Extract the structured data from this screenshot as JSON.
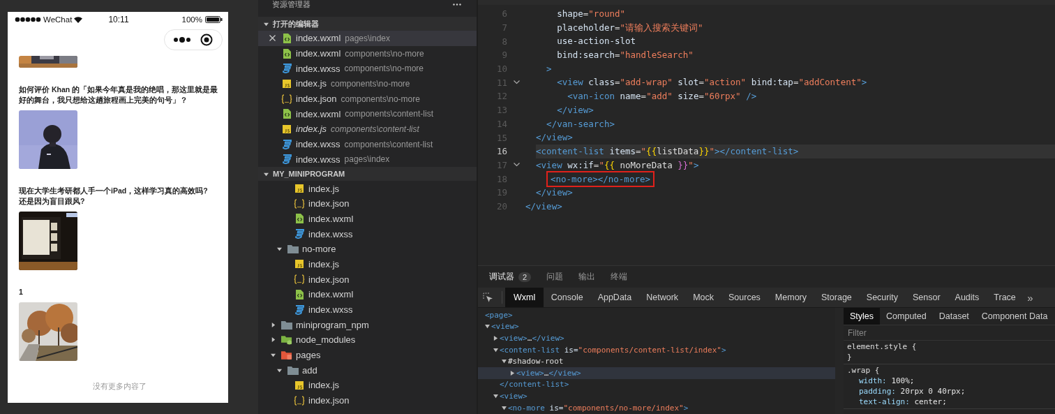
{
  "phone": {
    "status": {
      "carrier": "WeChat",
      "time": "10:11",
      "battery": "100%"
    },
    "posts": [
      {
        "kind": "picture"
      },
      {
        "title": "如何评价 Khan 的「如果今年真是我的绝唱，那这里就是最好的舞台，我只想给这趟旅程画上完美的句号」？",
        "kind": "picture"
      },
      {
        "title": "现在大学生考研都人手一个iPad，这样学习真的高效吗?\n还是因为盲目跟风?",
        "kind": "picture"
      },
      {
        "title": "1",
        "kind": "picture"
      }
    ],
    "footer": "没有更多内容了"
  },
  "explorer": {
    "title": "资源管理器",
    "open_editors": {
      "label": "打开的编辑器",
      "expanded": true,
      "items": [
        {
          "name": "index.wxml",
          "path": "pages\\index",
          "kind": "wxml",
          "selected": true,
          "preview": false
        },
        {
          "name": "index.wxml",
          "path": "components\\no-more",
          "kind": "wxml",
          "selected": false,
          "preview": false
        },
        {
          "name": "index.wxss",
          "path": "components\\no-more",
          "kind": "wxss",
          "selected": false,
          "preview": false
        },
        {
          "name": "index.js",
          "path": "components\\no-more",
          "kind": "js",
          "selected": false,
          "preview": false
        },
        {
          "name": "index.json",
          "path": "components\\no-more",
          "kind": "json",
          "selected": false,
          "preview": false
        },
        {
          "name": "index.wxml",
          "path": "components\\content-list",
          "kind": "wxml",
          "selected": false,
          "preview": false
        },
        {
          "name": "index.js",
          "path": "components\\content-list",
          "kind": "js",
          "selected": false,
          "preview": true
        },
        {
          "name": "index.wxss",
          "path": "components\\content-list",
          "kind": "wxss",
          "selected": false,
          "preview": false
        },
        {
          "name": "index.wxss",
          "path": "pages\\index",
          "kind": "wxss",
          "selected": false,
          "preview": false
        }
      ]
    },
    "project": {
      "label": "MY_MINIPROGRAM",
      "expanded": true,
      "tree": [
        {
          "kind": "continued",
          "children": [
            {
              "kind": "continued",
              "children": [
                {
                  "kind": "js",
                  "name": "index.js"
                },
                {
                  "kind": "json",
                  "name": "index.json"
                },
                {
                  "kind": "wxml",
                  "name": "index.wxml"
                },
                {
                  "kind": "wxss",
                  "name": "index.wxss"
                }
              ]
            },
            {
              "kind": "folder",
              "name": "no-more",
              "expanded": true,
              "children": [
                {
                  "kind": "js",
                  "name": "index.js"
                },
                {
                  "kind": "json",
                  "name": "index.json"
                },
                {
                  "kind": "wxml",
                  "name": "index.wxml"
                },
                {
                  "kind": "wxss",
                  "name": "index.wxss"
                }
              ]
            }
          ]
        },
        {
          "kind": "folder",
          "name": "miniprogram_npm",
          "expanded": false
        },
        {
          "kind": "node-folder",
          "name": "node_modules",
          "expanded": false
        },
        {
          "kind": "pages-folder",
          "name": "pages",
          "expanded": true,
          "children": [
            {
              "kind": "folder",
              "name": "add",
              "expanded": true,
              "children": [
                {
                  "kind": "js",
                  "name": "index.js"
                },
                {
                  "kind": "json",
                  "name": "index.json"
                }
              ]
            }
          ]
        }
      ]
    }
  },
  "editor": {
    "lines": [
      {
        "number": "6",
        "foldable": false,
        "current": false,
        "boxed": false,
        "tokens": [
          {
            "t": "      shape",
            "kind": "attr"
          },
          {
            "t": "=",
            "kind": "punct"
          },
          {
            "t": "\"round\"",
            "kind": "str"
          }
        ]
      },
      {
        "number": "7",
        "foldable": false,
        "current": false,
        "boxed": false,
        "tokens": [
          {
            "t": "      placeholder",
            "kind": "attr"
          },
          {
            "t": "=",
            "kind": "punct"
          },
          {
            "t": "\"请输入搜索关键词\"",
            "kind": "str"
          }
        ]
      },
      {
        "number": "8",
        "foldable": false,
        "current": false,
        "boxed": false,
        "tokens": [
          {
            "t": "      use-action-slot",
            "kind": "attr"
          }
        ]
      },
      {
        "number": "9",
        "foldable": false,
        "current": false,
        "boxed": false,
        "tokens": [
          {
            "t": "      bind:search",
            "kind": "attr"
          },
          {
            "t": "=",
            "kind": "punct"
          },
          {
            "t": "\"handleSearch\"",
            "kind": "str"
          }
        ]
      },
      {
        "number": "10",
        "foldable": false,
        "current": false,
        "boxed": false,
        "tokens": [
          {
            "t": "    >",
            "kind": "tag"
          }
        ]
      },
      {
        "number": "11",
        "foldable": true,
        "current": false,
        "boxed": false,
        "tokens": [
          {
            "t": "      <view",
            "kind": "tag"
          },
          {
            "t": " class",
            "kind": "attr"
          },
          {
            "t": "=",
            "kind": "punct"
          },
          {
            "t": "\"add-wrap\"",
            "kind": "str"
          },
          {
            "t": " slot",
            "kind": "attr"
          },
          {
            "t": "=",
            "kind": "punct"
          },
          {
            "t": "\"action\"",
            "kind": "str"
          },
          {
            "t": " bind:tap",
            "kind": "attr"
          },
          {
            "t": "=",
            "kind": "punct"
          },
          {
            "t": "\"addContent\"",
            "kind": "str"
          },
          {
            "t": ">",
            "kind": "tag"
          }
        ]
      },
      {
        "number": "12",
        "foldable": false,
        "current": false,
        "boxed": false,
        "tokens": [
          {
            "t": "        <van-icon",
            "kind": "tag"
          },
          {
            "t": " name",
            "kind": "attr"
          },
          {
            "t": "=",
            "kind": "punct"
          },
          {
            "t": "\"add\"",
            "kind": "str"
          },
          {
            "t": " size",
            "kind": "attr"
          },
          {
            "t": "=",
            "kind": "punct"
          },
          {
            "t": "\"60rpx\"",
            "kind": "str"
          },
          {
            "t": " />",
            "kind": "tag"
          }
        ]
      },
      {
        "number": "13",
        "foldable": false,
        "current": false,
        "boxed": false,
        "tokens": [
          {
            "t": "      </view>",
            "kind": "tag"
          }
        ]
      },
      {
        "number": "14",
        "foldable": false,
        "current": false,
        "boxed": false,
        "tokens": [
          {
            "t": "    </van-search>",
            "kind": "tag"
          }
        ]
      },
      {
        "number": "15",
        "foldable": false,
        "current": false,
        "boxed": false,
        "tokens": [
          {
            "t": "  </view>",
            "kind": "tag"
          }
        ]
      },
      {
        "number": "16",
        "foldable": false,
        "current": true,
        "boxed": false,
        "tokens": [
          {
            "t": "  <content-list",
            "kind": "tag"
          },
          {
            "t": " items",
            "kind": "attr"
          },
          {
            "t": "=",
            "kind": "punct"
          },
          {
            "t": "\"",
            "kind": "str"
          },
          {
            "t": "{{",
            "kind": "brace"
          },
          {
            "t": "listData",
            "kind": "var"
          },
          {
            "t": "}}",
            "kind": "brace"
          },
          {
            "t": "\"",
            "kind": "str"
          },
          {
            "t": "></content-list>",
            "kind": "tag"
          }
        ]
      },
      {
        "number": "17",
        "foldable": true,
        "current": false,
        "boxed": false,
        "tokens": [
          {
            "t": "  <view",
            "kind": "tag"
          },
          {
            "t": " wx:if",
            "kind": "attr"
          },
          {
            "t": "=",
            "kind": "punct"
          },
          {
            "t": "\"",
            "kind": "str"
          },
          {
            "t": "{{",
            "kind": "brace"
          },
          {
            "t": " noMoreData ",
            "kind": "var"
          },
          {
            "t": "}}",
            "kind": "brace2"
          },
          {
            "t": "\"",
            "kind": "str"
          },
          {
            "t": ">",
            "kind": "tag"
          }
        ]
      },
      {
        "number": "18",
        "foldable": false,
        "current": false,
        "boxed": true,
        "tokens": [
          {
            "t": "    <no-more></no-more>",
            "kind": "tag"
          }
        ]
      },
      {
        "number": "19",
        "foldable": false,
        "current": false,
        "boxed": false,
        "tokens": [
          {
            "t": "  </view>",
            "kind": "tag"
          }
        ]
      },
      {
        "number": "20",
        "foldable": false,
        "current": false,
        "boxed": false,
        "tokens": [
          {
            "t": "</view>",
            "kind": "tag"
          }
        ]
      }
    ]
  },
  "devtools": {
    "panel_tabs": [
      {
        "label": "调试器",
        "badge": "2",
        "selected": true
      },
      {
        "label": "问题",
        "selected": false
      },
      {
        "label": "输出",
        "selected": false
      },
      {
        "label": "终端",
        "selected": false
      }
    ],
    "tool_tabs": [
      {
        "label": "Wxml",
        "selected": true
      },
      {
        "label": "Console",
        "selected": false
      },
      {
        "label": "AppData",
        "selected": false
      },
      {
        "label": "Network",
        "selected": false
      },
      {
        "label": "Mock",
        "selected": false
      },
      {
        "label": "Sources",
        "selected": false
      },
      {
        "label": "Memory",
        "selected": false
      },
      {
        "label": "Storage",
        "selected": false
      },
      {
        "label": "Security",
        "selected": false
      },
      {
        "label": "Sensor",
        "selected": false
      },
      {
        "label": "Audits",
        "selected": false
      },
      {
        "label": "Trace",
        "selected": false
      }
    ],
    "more": "»",
    "tree": [
      {
        "tokens": [
          {
            "t": "<page>",
            "kind": "tag"
          }
        ],
        "selected": false
      },
      {
        "tokens": [
          {
            "t": "<view>",
            "kind": "tag"
          }
        ],
        "expanded": true,
        "selected": false,
        "children": [
          {
            "tokens": [
              {
                "t": "<view>",
                "kind": "tag"
              },
              {
                "t": "…",
                "kind": "plain"
              },
              {
                "t": "</view>",
                "kind": "tag"
              }
            ],
            "expanded": false,
            "selected": false
          },
          {
            "tokens": [
              {
                "t": "<content-list",
                "kind": "tag"
              },
              {
                "t": " is=",
                "kind": "attr"
              },
              {
                "t": "\"components/content-list/index\"",
                "kind": "str"
              },
              {
                "t": ">",
                "kind": "tag"
              }
            ],
            "expanded": true,
            "selected": false,
            "children": [
              {
                "tokens": [
                  {
                    "t": "#shadow-root",
                    "kind": "plain"
                  }
                ],
                "expanded": true,
                "selected": false,
                "children": [
                  {
                    "tokens": [
                      {
                        "t": "<view>",
                        "kind": "tag"
                      },
                      {
                        "t": "…",
                        "kind": "plain"
                      },
                      {
                        "t": "</view>",
                        "kind": "tag"
                      }
                    ],
                    "expanded": false,
                    "selected": true
                  }
                ]
              }
            ],
            "closing": [
              {
                "t": "</content-list>",
                "kind": "tag"
              }
            ]
          },
          {
            "tokens": [
              {
                "t": "<view>",
                "kind": "tag"
              }
            ],
            "expanded": true,
            "selected": false,
            "children": [
              {
                "tokens": [
                  {
                    "t": "<no-more",
                    "kind": "tag"
                  },
                  {
                    "t": " is=",
                    "kind": "attr"
                  },
                  {
                    "t": "\"components/no-more/index\"",
                    "kind": "str"
                  },
                  {
                    "t": ">",
                    "kind": "tag"
                  }
                ],
                "expanded": true,
                "selected": false
              }
            ]
          }
        ]
      }
    ],
    "styles": {
      "tabs": [
        {
          "label": "Styles",
          "selected": true
        },
        {
          "label": "Computed",
          "selected": false
        },
        {
          "label": "Dataset",
          "selected": false
        },
        {
          "label": "Component Data",
          "selected": false
        }
      ],
      "filter_placeholder": "Filter",
      "rules": [
        {
          "open": "element.style {",
          "close": "}"
        },
        {
          "open": ".wrap {",
          "props": [
            {
              "name": "width:",
              "value": "100%;"
            },
            {
              "name": "padding:",
              "value": "20rpx 0 40rpx;"
            },
            {
              "name": "text-align:",
              "value": "center;"
            }
          ]
        }
      ]
    }
  }
}
